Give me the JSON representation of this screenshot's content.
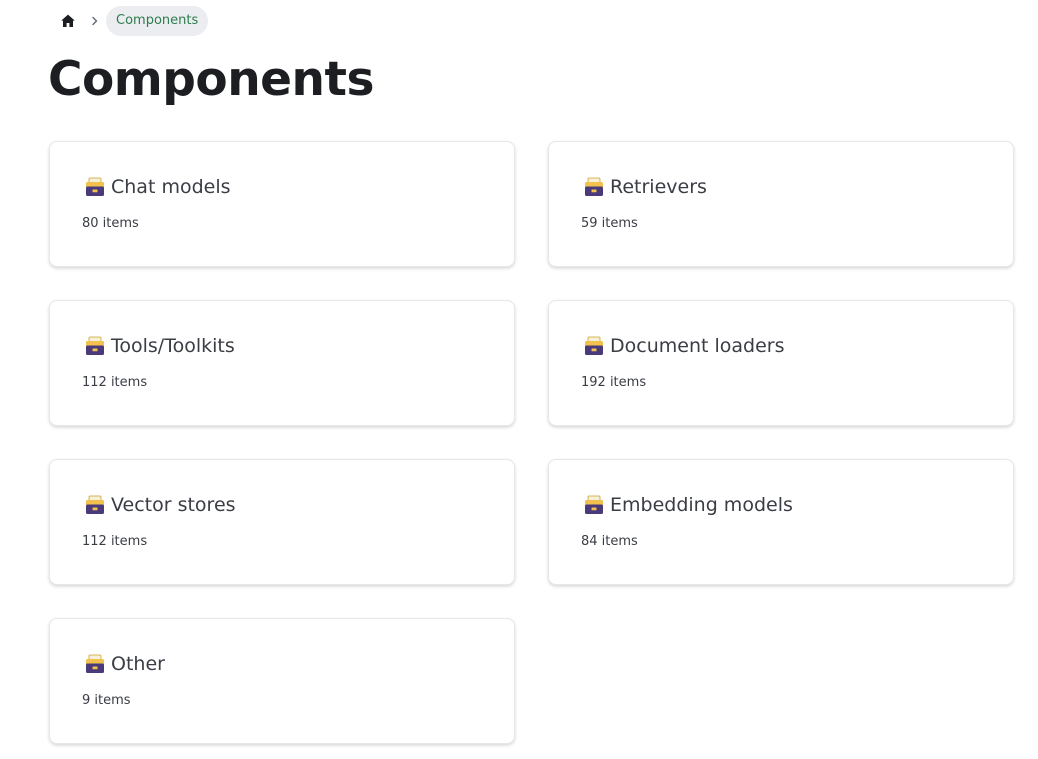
{
  "breadcrumb": {
    "home_icon": "home-icon",
    "separator_icon": "chevron-right-icon",
    "current": "Components"
  },
  "page": {
    "title": "Components"
  },
  "cards": [
    {
      "icon": "card-file-box-icon",
      "title": "Chat models",
      "count": "80 items"
    },
    {
      "icon": "card-file-box-icon",
      "title": "Retrievers",
      "count": "59 items"
    },
    {
      "icon": "card-file-box-icon",
      "title": "Tools/Toolkits",
      "count": "112 items"
    },
    {
      "icon": "card-file-box-icon",
      "title": "Document loaders",
      "count": "192 items"
    },
    {
      "icon": "card-file-box-icon",
      "title": "Vector stores",
      "count": "112 items"
    },
    {
      "icon": "card-file-box-icon",
      "title": "Embedding models",
      "count": "84 items"
    },
    {
      "icon": "card-file-box-icon",
      "title": "Other",
      "count": "9 items"
    }
  ],
  "colors": {
    "breadcrumb_active_text": "#2e7d4f",
    "breadcrumb_active_bg": "#ebedf0",
    "icon_box": "#4a3a7a",
    "icon_lid": "#f2c14e"
  }
}
